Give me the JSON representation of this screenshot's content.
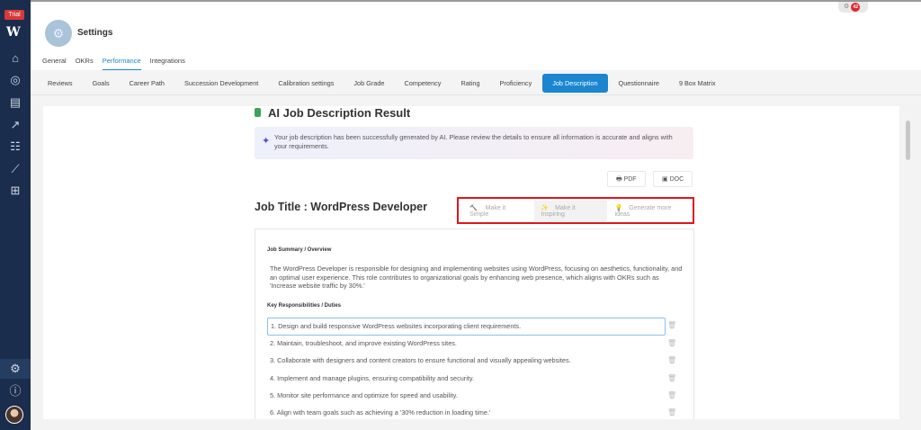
{
  "sidebar": {
    "trial": "Trial",
    "logo": "W",
    "icons": [
      "home-icon",
      "target-icon",
      "clipboard-icon",
      "chart-rising-icon",
      "team-icon",
      "analytics-icon",
      "apps-icon"
    ]
  },
  "header": {
    "title": "Settings",
    "notification_count": "42",
    "tabs": [
      "General",
      "OKRs",
      "Performance",
      "Integrations"
    ],
    "active_tab": "Performance"
  },
  "subtabs": {
    "items": [
      "Reviews",
      "Goals",
      "Career Path",
      "Succession Development",
      "Calibration settings",
      "Job Grade",
      "Competency",
      "Rating",
      "Proficiency",
      "Job Description",
      "Questionnaire",
      "9 Box Matrix"
    ],
    "active": "Job Description"
  },
  "main": {
    "title": "AI Job Description Result",
    "banner": "Your job description has been successfully generated by AI. Please review the details to ensure all information is accurate and aligns with your requirements.",
    "pdf_label": "PDF",
    "doc_label": "DOC",
    "job_title": "Job Title : WordPress Developer",
    "ai_actions": {
      "simple": "Make it Simple",
      "inspiring": "Make it Inspiring",
      "more": "Generate more ideas"
    },
    "summary_label": "Job Summary / Overview",
    "summary": "The WordPress Developer is responsible for designing and implementing websites using WordPress, focusing on aesthetics, functionality, and an optimal user experience. This role contributes to organizational goals by enhancing web presence, which aligns with OKRs such as 'Increase website traffic by 30%.'",
    "responsibilities_label": "Key Responsibilities / Duties",
    "responsibilities": [
      "1. Design and build responsive WordPress websites incorporating client requirements.",
      "2. Maintain, troubleshoot, and improve existing WordPress sites.",
      "3. Collaborate with designers and content creators to ensure functional and visually appealing websites.",
      "4. Implement and manage plugins, ensuring compatibility and security.",
      "5. Monitor site performance and optimize for speed and usability.",
      "6. Align with team goals such as achieving a '30% reduction in loading time.'"
    ]
  }
}
